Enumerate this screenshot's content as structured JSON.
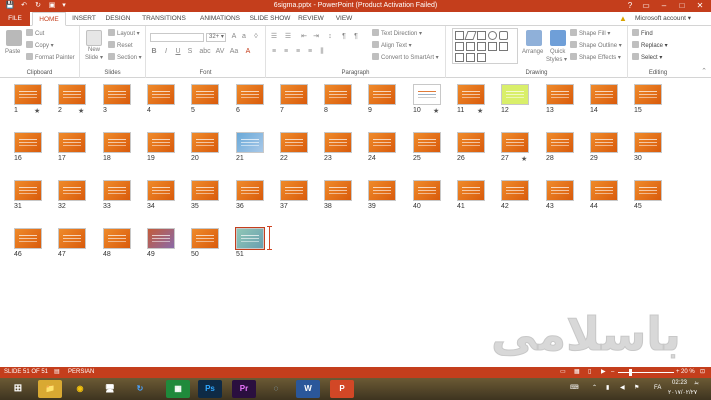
{
  "titlebar": {
    "title": "6sigma.pptx - PowerPoint (Product Activation Failed)",
    "quick_access": [
      "💾",
      "↶",
      "↻",
      "▣",
      "▾"
    ],
    "window_controls": [
      "?",
      "▭",
      "–",
      "□",
      "✕"
    ]
  },
  "tabs": [
    "FILE",
    "HOME",
    "INSERT",
    "DESIGN",
    "TRANSITIONS",
    "ANIMATIONS",
    "SLIDE SHOW",
    "REVIEW",
    "VIEW"
  ],
  "account": "Microsoft account ▾",
  "ribbon": {
    "clipboard": {
      "label": "Clipboard",
      "paste": "Paste",
      "cut": "Cut",
      "copy": "Copy ▾",
      "format_painter": "Format Painter"
    },
    "slides": {
      "label": "Slides",
      "new_slide": "New",
      "new_slide2": "Slide ▾",
      "layout": "Layout ▾",
      "reset": "Reset",
      "section": "Section ▾"
    },
    "font": {
      "label": "Font",
      "size": "32+ ▾",
      "buttons": [
        "B",
        "I",
        "U",
        "S",
        "abc",
        "AV",
        "Aa",
        "A"
      ]
    },
    "paragraph": {
      "label": "Paragraph",
      "text_direction": "Text Direction ▾",
      "align_text": "Align Text ▾",
      "smartart": "Convert to SmartArt ▾"
    },
    "drawing": {
      "label": "Drawing",
      "arrange": "Arrange",
      "quick_styles": "Quick",
      "quick_styles2": "Styles ▾",
      "shape_fill": "Shape Fill ▾",
      "shape_outline": "Shape Outline ▾",
      "shape_effects": "Shape Effects ▾"
    },
    "editing": {
      "label": "Editing",
      "find": "Find",
      "replace": "Replace ▾",
      "select": "Select ▾"
    }
  },
  "slides": [
    {
      "n": "1",
      "star": true
    },
    {
      "n": "2",
      "star": true
    },
    {
      "n": "3"
    },
    {
      "n": "4"
    },
    {
      "n": "5"
    },
    {
      "n": "6"
    },
    {
      "n": "7"
    },
    {
      "n": "8"
    },
    {
      "n": "9"
    },
    {
      "n": "10",
      "star": true,
      "kind": "white"
    },
    {
      "n": "11",
      "star": true
    },
    {
      "n": "12",
      "kind": "green"
    },
    {
      "n": "13"
    },
    {
      "n": "14"
    },
    {
      "n": "15"
    },
    {
      "n": "16"
    },
    {
      "n": "17"
    },
    {
      "n": "18"
    },
    {
      "n": "19"
    },
    {
      "n": "20"
    },
    {
      "n": "21",
      "kind": "blue"
    },
    {
      "n": "22"
    },
    {
      "n": "23"
    },
    {
      "n": "24"
    },
    {
      "n": "25"
    },
    {
      "n": "26"
    },
    {
      "n": "27",
      "star": true
    },
    {
      "n": "28"
    },
    {
      "n": "29"
    },
    {
      "n": "30"
    },
    {
      "n": "31"
    },
    {
      "n": "32"
    },
    {
      "n": "33"
    },
    {
      "n": "34"
    },
    {
      "n": "35"
    },
    {
      "n": "36"
    },
    {
      "n": "37"
    },
    {
      "n": "38"
    },
    {
      "n": "39"
    },
    {
      "n": "40"
    },
    {
      "n": "41"
    },
    {
      "n": "42"
    },
    {
      "n": "43"
    },
    {
      "n": "44"
    },
    {
      "n": "45"
    },
    {
      "n": "46"
    },
    {
      "n": "47"
    },
    {
      "n": "48"
    },
    {
      "n": "49",
      "kind": "mixed"
    },
    {
      "n": "50"
    },
    {
      "n": "51",
      "kind": "teal",
      "selected": true
    }
  ],
  "star_glyph": "★",
  "watermark": "باسلامی",
  "statusbar": {
    "slide_info": "SLIDE 51 OF 51",
    "language": "PERSIAN",
    "zoom": "20 %",
    "zoom_fraction": 0.2
  },
  "taskbar": {
    "apps": [
      "📁",
      "◉",
      "🖥",
      "↻",
      "▦",
      "Ps",
      "Pr",
      "◌",
      "W",
      "P"
    ],
    "tray_lang": "FA",
    "time": "02:23",
    "date": "۲۰۱۷/۰۲/۲۷",
    "day": "بد"
  },
  "colors": {
    "accent": "#c43e1c",
    "slide_orange": "#e2731c"
  }
}
